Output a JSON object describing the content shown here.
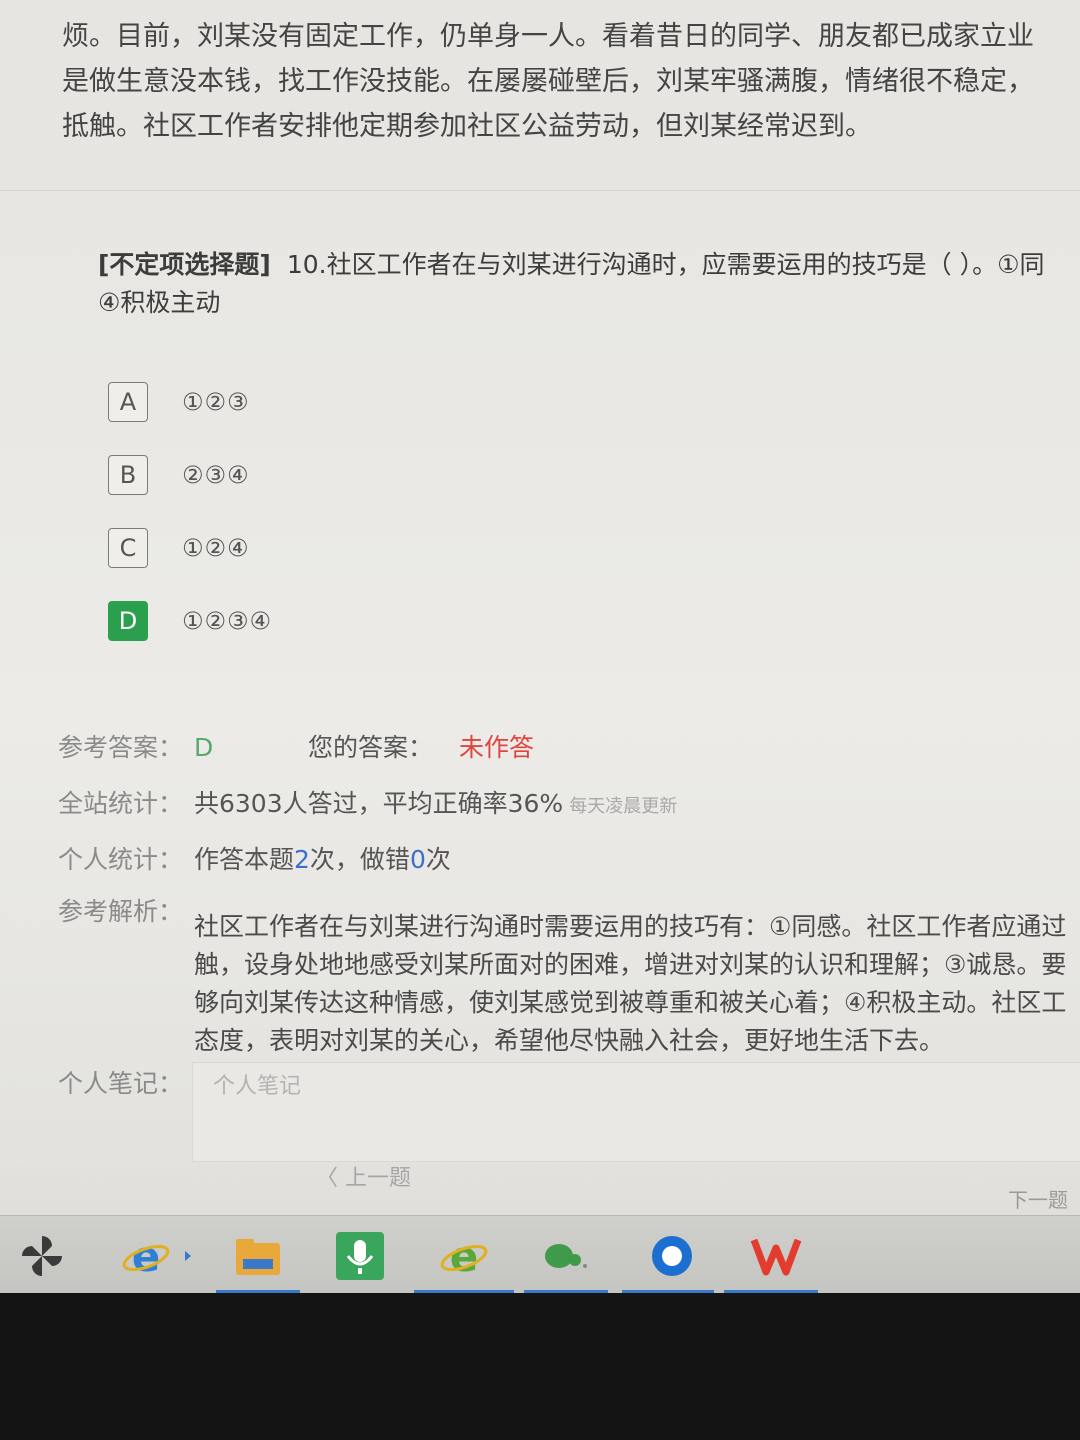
{
  "passage": {
    "lines": [
      "烦。目前，刘某没有固定工作，仍单身一人。看着昔日的同学、朋友都已成家立业",
      "是做生意没本钱，找工作没技能。在屡屡碰壁后，刘某牢骚满腹，情绪很不稳定，",
      "抵触。社区工作者安排他定期参加社区公益劳动，但刘某经常迟到。"
    ]
  },
  "question": {
    "type": "[不定项选择题]",
    "text_line1": "10.社区工作者在与刘某进行沟通时，应需要运用的技巧是（   ）。①同",
    "text_line2": "④积极主动"
  },
  "options": [
    {
      "letter": "A",
      "text": "①②③",
      "selected": false
    },
    {
      "letter": "B",
      "text": "②③④",
      "selected": false
    },
    {
      "letter": "C",
      "text": "①②④",
      "selected": false
    },
    {
      "letter": "D",
      "text": "①②③④",
      "selected": true
    }
  ],
  "answer": {
    "ref_label": "参考答案：",
    "ref_value": "D",
    "your_label": "您的答案：",
    "your_value": "未作答"
  },
  "site_stats": {
    "label": "全站统计：",
    "text": "共6303人答过，平均正确率36%",
    "note": "每天凌晨更新"
  },
  "personal_stats": {
    "label": "个人统计：",
    "prefix": "作答本题",
    "count": "2",
    "mid": "次，做错",
    "wrong": "0",
    "suffix": "次"
  },
  "analysis": {
    "label": "参考解析：",
    "lines": [
      "社区工作者在与刘某进行沟通时需要运用的技巧有：①同感。社区工作者应通过",
      "触，设身处地地感受刘某所面对的困难，增进对刘某的认识和理解；③诚恳。要",
      "够向刘某传达这种情感，使刘某感觉到被尊重和被关心着；④积极主动。社区工",
      "态度，表明对刘某的关心，希望他尽快融入社会，更好地生活下去。"
    ]
  },
  "note": {
    "label": "个人笔记：",
    "placeholder": "个人笔记"
  },
  "nav": {
    "prev": "〈 上一题",
    "next": "下一题"
  },
  "taskbar": {
    "icons": [
      "pinwheel-app-icon",
      "ie-browser-icon",
      "file-explorer-icon",
      "voice-recorder-icon",
      "ie-green-browser-icon",
      "green-app-icon",
      "blue-circle-app-icon",
      "wps-office-icon"
    ]
  },
  "colors": {
    "selected_option": "#2aa04f",
    "ref_answer": "#58a86e",
    "unanswered": "#e0443f",
    "count_highlight": "#3a72c9"
  }
}
